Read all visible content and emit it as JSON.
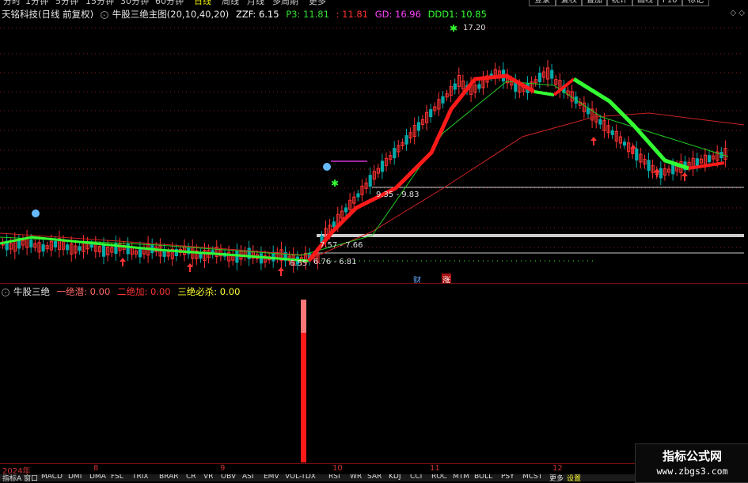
{
  "topbar": {
    "timeframes": [
      "分时",
      "1分钟",
      "5分钟",
      "15分钟",
      "30分钟",
      "60分钟",
      "日线",
      "周线",
      "月线",
      "多周期",
      "更多"
    ],
    "active": "日线",
    "buttons": [
      "登录",
      "复权",
      "叠加",
      "统计",
      "画线",
      "F10",
      "标记"
    ]
  },
  "main": {
    "stock_name": "天铭科技",
    "period_label": "(日线 前复权)",
    "indicator_name": "牛股三绝主图",
    "indicator_params": "(20,10,40,20)",
    "zzf_label": "ZZF: 6.15",
    "p3_label": "P3: 11.81",
    "p3b_label": ": 11.81",
    "gd_label": "GD: 16.96",
    "ddd1_label": "DDD1: 10.85",
    "annotations": {
      "high": "17.20",
      "range1": "9.35 - 9.83",
      "range2": "7.57 - 7.66",
      "range3": "6.55",
      "range4": "6.76 - 6.81",
      "cai": "财",
      "zhang": "涨"
    }
  },
  "sub": {
    "indicator_name": "牛股三绝",
    "one_label": "一绝潜: 0.00",
    "two_label": "二绝加: 0.00",
    "three_label": "三绝必杀: 0.00"
  },
  "xaxis": {
    "labels": [
      "2024年",
      "8",
      "9",
      "10",
      "11",
      "12"
    ]
  },
  "bottombar": {
    "tabs": [
      "指标A",
      "窗口",
      "MACD",
      "DMI",
      "DMA",
      "FSL",
      "TRIX",
      "BRAR",
      "CR",
      "VR",
      "OBV",
      "ASI",
      "EMV",
      "VOL-TDX",
      "RSI",
      "WR",
      "SAR",
      "KDJ",
      "CCI",
      "ROC",
      "MTM",
      "BOLL",
      "PSY",
      "MCST",
      "更多",
      "设置"
    ]
  },
  "watermark": {
    "title": "指标公式网",
    "url": "www.zbgs3.com"
  },
  "colors": {
    "up": "#ff3333",
    "down": "#00aaaa",
    "bull_line": "#ff1a1a",
    "bear_line": "#33ff33",
    "ma_red": "#cc2222",
    "ma_green": "#22cc22"
  }
}
